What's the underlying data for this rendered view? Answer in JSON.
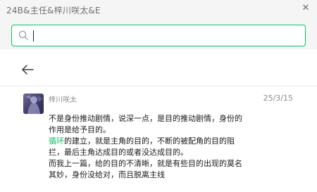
{
  "window": {
    "title": "24B&主任&梓川咲太&E",
    "close_glyph": "✕"
  },
  "search": {
    "value": "",
    "placeholder": "",
    "accent": "#07c160"
  },
  "message": {
    "sender": "梓川咲太",
    "date": "25/3/15",
    "lines": [
      {
        "pre": "",
        "hl": "",
        "post": "不是身份推动剧情，说深一点，是目的推动剧情，身份的"
      },
      {
        "pre": "",
        "hl": "",
        "post": "作用是给予目的。"
      },
      {
        "pre": "",
        "hl": "循环",
        "post": "的建立，就是主角的目的，不断的被配角的目的阻"
      },
      {
        "pre": "",
        "hl": "",
        "post": "拦，最后主角达成目的或者没达成目的。"
      },
      {
        "pre": "",
        "hl": "",
        "post": "而我上一篇，给的目的不清晰，就是有些目的出现的莫名"
      },
      {
        "pre": "",
        "hl": "",
        "post": "其妙，身份没给对，而且脱离主线"
      }
    ],
    "highlight_color": "#07c160"
  },
  "icons": {
    "search": "search-icon",
    "back": "arrow-left-icon",
    "close": "close-icon",
    "avatar": "avatar"
  }
}
